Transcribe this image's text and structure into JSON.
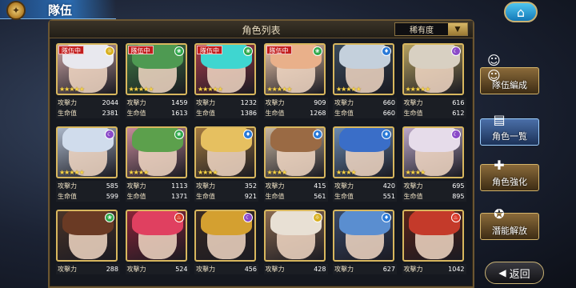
{
  "header": {
    "title": "隊伍",
    "home_icon": "home-icon"
  },
  "panel": {
    "title": "角色列表",
    "sort_label": "稀有度"
  },
  "labels": {
    "atk": "攻擊力",
    "hp": "生命值",
    "party_badge": "隊伍中"
  },
  "cards": [
    {
      "atk": "2044",
      "hp": "2381",
      "in_party": true,
      "element": "light",
      "stars": 5,
      "hair": "#e8e8ee",
      "bg": "#c9a2a2"
    },
    {
      "atk": "1459",
      "hp": "1613",
      "in_party": true,
      "element": "wind",
      "stars": 5,
      "hair": "#4e9a52",
      "bg": "#3f7a44"
    },
    {
      "atk": "1232",
      "hp": "1386",
      "in_party": true,
      "element": "wind",
      "stars": 5,
      "hair": "#3fd6d0",
      "bg": "#a63c4a"
    },
    {
      "atk": "909",
      "hp": "1268",
      "in_party": true,
      "element": "wind",
      "stars": 5,
      "hair": "#e9b08a",
      "bg": "#e8c4a8"
    },
    {
      "atk": "660",
      "hp": "660",
      "in_party": false,
      "element": "water",
      "stars": 5,
      "hair": "#c4d0dc",
      "bg": "#3a4a5a"
    },
    {
      "atk": "616",
      "hp": "612",
      "in_party": false,
      "element": "dark",
      "stars": 5,
      "hair": "#d8d0c2",
      "bg": "#b4a060"
    },
    {
      "atk": "585",
      "hp": "599",
      "in_party": false,
      "element": "dark",
      "stars": 5,
      "hair": "#d0dcec",
      "bg": "#aab6c8"
    },
    {
      "atk": "1113",
      "hp": "1371",
      "in_party": false,
      "element": "wind",
      "stars": 4,
      "hair": "#5ca04c",
      "bg": "#c68a9a"
    },
    {
      "atk": "352",
      "hp": "921",
      "in_party": false,
      "element": "water",
      "stars": 4,
      "hair": "#e6c060",
      "bg": "#a47a40"
    },
    {
      "atk": "415",
      "hp": "561",
      "in_party": false,
      "element": "water",
      "stars": 4,
      "hair": "#9a6a44",
      "bg": "#c8b6a0"
    },
    {
      "atk": "420",
      "hp": "551",
      "in_party": false,
      "element": "water",
      "stars": 4,
      "hair": "#3a6ec8",
      "bg": "#6a8ab0"
    },
    {
      "atk": "695",
      "hp": "895",
      "in_party": false,
      "element": "dark",
      "stars": 4,
      "hair": "#e6dcea",
      "bg": "#bca8c8"
    },
    {
      "atk": "288",
      "hp": "",
      "in_party": false,
      "element": "wind",
      "stars": 0,
      "hair": "#6a3a24",
      "bg": "#4a3428"
    },
    {
      "atk": "524",
      "hp": "",
      "in_party": false,
      "element": "fire",
      "stars": 0,
      "hair": "#e04060",
      "bg": "#8a2438"
    },
    {
      "atk": "456",
      "hp": "",
      "in_party": false,
      "element": "dark",
      "stars": 0,
      "hair": "#d4a030",
      "bg": "#3a2a22"
    },
    {
      "atk": "428",
      "hp": "",
      "in_party": false,
      "element": "light",
      "stars": 0,
      "hair": "#e8e0d4",
      "bg": "#8a6a50"
    },
    {
      "atk": "627",
      "hp": "",
      "in_party": false,
      "element": "water",
      "stars": 0,
      "hair": "#5a8ed0",
      "bg": "#3a4a68"
    },
    {
      "atk": "1042",
      "hp": "",
      "in_party": false,
      "element": "fire",
      "stars": 0,
      "hair": "#c43a2a",
      "bg": "#5a2418"
    }
  ],
  "side_menu": [
    {
      "label": "隊伍編成",
      "icon": "team-icon",
      "active": false
    },
    {
      "label": "角色一覧",
      "icon": "book-icon",
      "active": true
    },
    {
      "label": "角色強化",
      "icon": "power-up-icon",
      "active": false
    },
    {
      "label": "潛能解放",
      "icon": "potential-icon",
      "active": false
    }
  ],
  "back": {
    "label": "返回",
    "icon": "back-arrow-icon"
  },
  "element_colors": {
    "light": "#d8b020",
    "wind": "#2ea84a",
    "water": "#2a7ad8",
    "dark": "#8a4ac8",
    "fire": "#d83a2a"
  }
}
